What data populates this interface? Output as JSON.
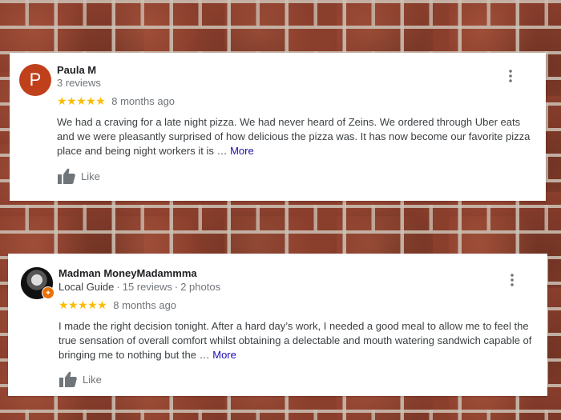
{
  "reviews": [
    {
      "avatar_letter": "P",
      "avatar_color": "#c0401c",
      "name": "Paula M",
      "guide_label": "",
      "review_count": "3 reviews",
      "photo_count": "",
      "rating": 5,
      "stars": "★★★★★",
      "time_ago": "8 months ago",
      "text": "We had a craving for a late night pizza. We had never heard of Zeins. We ordered through Uber eats and we were pleasantly surprised of how delicious the pizza was. It has now become our favorite pizza place and being night workers it is …",
      "more_label": "More",
      "like_label": "Like"
    },
    {
      "avatar_letter": "",
      "name": "Madman MoneyMadammma",
      "guide_label": "Local Guide",
      "review_count": "15 reviews",
      "photo_count": "2 photos",
      "rating": 5,
      "stars": "★★★★★",
      "time_ago": "8 months ago",
      "text": "I made the right decision tonight. After a hard day’s work, I needed a good meal to allow me to feel the true sensation of overall comfort whilst obtaining a delectable and mouth watering sandwich capable of bringing me to nothing but the …",
      "more_label": "More",
      "like_label": "Like"
    }
  ],
  "colors": {
    "star": "#fbbc04",
    "link": "#1a0dab",
    "local_guide_badge": "#e8710a"
  },
  "icons": {
    "like": "thumb-up-icon",
    "menu": "more-vert-icon",
    "badge": "local-guide-badge-icon"
  }
}
